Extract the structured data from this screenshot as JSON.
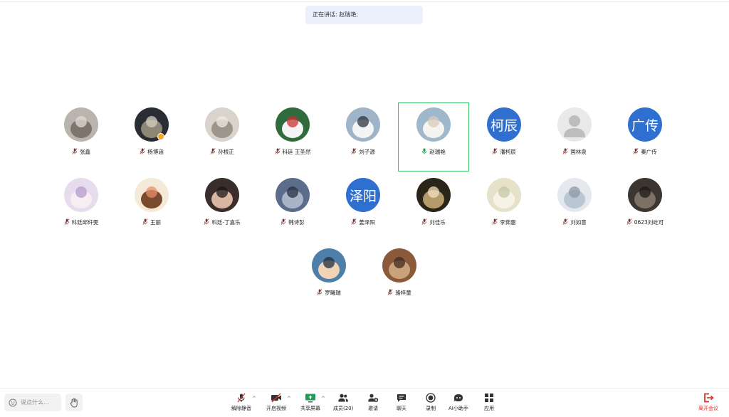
{
  "speaking": {
    "text": "正在讲话: 赵瑞艳;"
  },
  "participants": [
    {
      "name": "张鑫",
      "avatar_kind": "photo-indoor",
      "mic": "muted"
    },
    {
      "name": "杨博涵",
      "avatar_kind": "photo-desk",
      "mic": "muted",
      "host_badge": true
    },
    {
      "name": "孙根正",
      "avatar_kind": "photo-cat-face",
      "mic": "muted"
    },
    {
      "name": "科廷 王圣然",
      "avatar_kind": "cartoon-christmas",
      "mic": "muted"
    },
    {
      "name": "刘子源",
      "avatar_kind": "photo-snow-mountain",
      "mic": "muted"
    },
    {
      "name": "赵瑞艳",
      "avatar_kind": "photo-white-dog",
      "mic": "active",
      "active_speaker": true
    },
    {
      "name": "潘柯辰",
      "avatar_kind": "text",
      "avatar_text": "柯辰",
      "mic": "muted"
    },
    {
      "name": "国林泉",
      "avatar_kind": "default-person",
      "mic": "muted"
    },
    {
      "name": "秦广传",
      "avatar_kind": "text",
      "avatar_text": "广传",
      "mic": "muted"
    },
    {
      "name": "科廷邱纤雯",
      "avatar_kind": "photo-pastel",
      "mic": "muted"
    },
    {
      "name": "王丽",
      "avatar_kind": "cartoon-girl",
      "mic": "muted"
    },
    {
      "name": "科廷-丁嘉乐",
      "avatar_kind": "photo-girl",
      "mic": "muted"
    },
    {
      "name": "韩诗彭",
      "avatar_kind": "photo-jacket",
      "mic": "muted"
    },
    {
      "name": "姜泽阳",
      "avatar_kind": "text",
      "avatar_text": "泽阳",
      "mic": "muted"
    },
    {
      "name": "刘佳乐",
      "avatar_kind": "photo-dark-portrait",
      "mic": "muted"
    },
    {
      "name": "李茹惠",
      "avatar_kind": "anime-girl",
      "mic": "muted"
    },
    {
      "name": "刘如意",
      "avatar_kind": "photo-cat-blanket",
      "mic": "muted"
    },
    {
      "name": "0623刘屹可",
      "avatar_kind": "photo-car",
      "mic": "muted"
    },
    {
      "name": "罗曦瑞",
      "avatar_kind": "photo-boy",
      "mic": "muted"
    },
    {
      "name": "骆梓童",
      "avatar_kind": "photo-room",
      "mic": "muted"
    }
  ],
  "toolbar": {
    "chat_placeholder": "说点什么...",
    "unmute": "解除静音",
    "start_video": "开启视频",
    "share_screen": "共享屏幕",
    "members": "成员(20)",
    "invite": "邀请",
    "chat": "聊天",
    "record": "录制",
    "ai_assistant": "AI小助手",
    "apps": "应用",
    "leave": "离开会议"
  },
  "colors": {
    "accent_blue": "#2f6fd0",
    "active_border": "#3cc46a",
    "leave_red": "#d9342b",
    "banner_bg": "#eaf1fd"
  }
}
